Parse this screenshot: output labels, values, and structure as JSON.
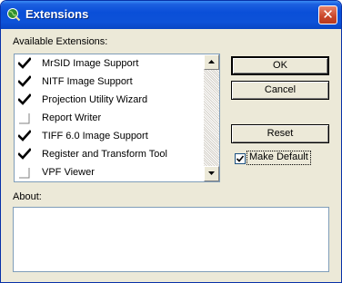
{
  "window": {
    "title": "Extensions"
  },
  "extensions_label": "Available Extensions:",
  "extensions": [
    {
      "label": "MrSID Image Support",
      "checked": true
    },
    {
      "label": "NITF Image Support",
      "checked": true
    },
    {
      "label": "Projection Utility Wizard",
      "checked": true
    },
    {
      "label": "Report Writer",
      "checked": false
    },
    {
      "label": "TIFF 6.0 Image Support",
      "checked": true
    },
    {
      "label": "Register and Transform Tool",
      "checked": true
    },
    {
      "label": "VPF Viewer",
      "checked": false
    }
  ],
  "buttons": {
    "ok": "OK",
    "cancel": "Cancel",
    "reset": "Reset"
  },
  "make_default": {
    "label": "Make Default",
    "checked": true
  },
  "about_label": "About:",
  "about_text": "",
  "colors": {
    "titlebar": "#0a4fd8",
    "window_bg": "#ece9d8",
    "close_button": "#c9462a",
    "list_border": "#7f9db9"
  }
}
